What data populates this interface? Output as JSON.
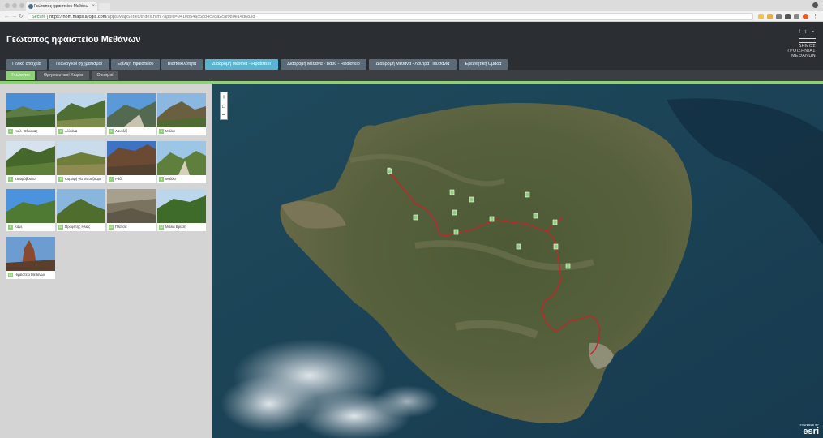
{
  "browser": {
    "tab_title": "Γεώτοπος ηφαιστείου Μεθάνω",
    "tab_close": "×",
    "url_secure": "Secure",
    "url_host": "https://nom.maps.arcgis.com",
    "url_path": "/apps/MapSeries/index.html?appid=941eb54ac5db4ce8a2caf980e14d6838"
  },
  "header": {
    "title": "Γεώτοπος ηφαιστείου Μεθάνων",
    "social": "f  t  ⚭",
    "logo_line1": "ΔΗΜΟΣ",
    "logo_line2": "ΤΡΟΙΖΗΝΙΑΣ",
    "logo_line3": "ΜΕΘΑΝΩΝ"
  },
  "main_tabs": [
    {
      "label": "Γενικά στοιχεία"
    },
    {
      "label": "Γεωλογικοί σχηματισμοί"
    },
    {
      "label": "Εξέλιξη ηφαιστείου"
    },
    {
      "label": "Βιοποικιλότητα"
    },
    {
      "label": "Διαδρομή Μέθανα - Ηφαίστειο"
    },
    {
      "label": "Διαδρομή Μέθανα - Βαθύ - Ηφαίστειο"
    },
    {
      "label": "Διαδρομή Μέθανα - Λουτρά Παυσανία"
    },
    {
      "label": "Ερευνητική Ομάδα"
    }
  ],
  "sub_tabs": [
    {
      "label": "Γεώτοποι"
    },
    {
      "label": "Θρησκευτικοί Χώροι"
    },
    {
      "label": "Οικισμοί"
    }
  ],
  "places": [
    {
      "num": "1",
      "caption": "Κοιλ. 'Οξυακας"
    },
    {
      "num": "2",
      "caption": "Αλλιάνα"
    },
    {
      "num": "3",
      "caption": "Λαυτζέζ"
    },
    {
      "num": "4",
      "caption": "Μάλια"
    },
    {
      "num": "5",
      "caption": "Σταυρόβουνο"
    },
    {
      "num": "6",
      "caption": "Κορυφή νίο Μπούζκαρι"
    },
    {
      "num": "7",
      "caption": "Ράδι"
    },
    {
      "num": "8",
      "caption": "Μάλλα"
    },
    {
      "num": "9",
      "caption": "Κάνε"
    },
    {
      "num": "10",
      "caption": "Προφήτης Ηλίας"
    },
    {
      "num": "11",
      "caption": "Πλάτσα"
    },
    {
      "num": "12",
      "caption": "Μάλια Βρύση"
    },
    {
      "num": "13",
      "caption": "Ηφαίστειο Μεθάνων"
    }
  ],
  "map": {
    "zoom_in": "+",
    "home": "⌂",
    "zoom_out": "−",
    "attribution_small": "POWERED BY",
    "attribution": "esri"
  },
  "colors": {
    "accent_green": "#8fcf7a",
    "active_tab": "#57b5d2",
    "route": "#c0262b"
  }
}
